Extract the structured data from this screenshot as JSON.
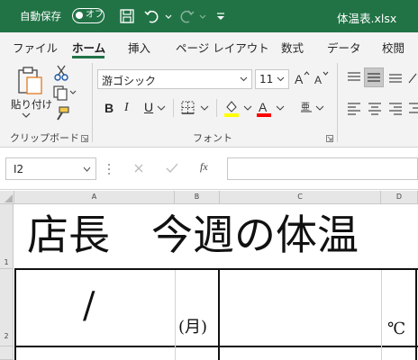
{
  "titlebar": {
    "autosave_label": "自動保存",
    "autosave_state": "オフ",
    "filename": "体温表.xlsx",
    "accent_color": "#217346"
  },
  "tabs": [
    {
      "label": "ファイル",
      "active": false
    },
    {
      "label": "ホーム",
      "active": true
    },
    {
      "label": "挿入",
      "active": false
    },
    {
      "label": "ページ レイアウト",
      "active": false
    },
    {
      "label": "数式",
      "active": false
    },
    {
      "label": "データ",
      "active": false
    },
    {
      "label": "校閲",
      "active": false
    }
  ],
  "ribbon": {
    "clipboard": {
      "paste_label": "貼り付け",
      "group_label": "クリップボード"
    },
    "font": {
      "font_name": "游ゴシック",
      "font_size": "11",
      "group_label": "フォント",
      "bold_label": "B",
      "italic_label": "I",
      "underline_label": "U",
      "highlight_color": "#ffff00",
      "font_color": "#ff0000",
      "phonetic_glyph": "亜"
    }
  },
  "formula_bar": {
    "name_box": "I2",
    "fx_label": "fx",
    "formula": ""
  },
  "grid": {
    "columns": [
      "A",
      "B",
      "C",
      "D"
    ],
    "rows": [
      "1",
      "2"
    ],
    "cells": {
      "row1_title": "店長　今週の体温",
      "a2": "/",
      "b2": "(月)",
      "d2": "℃"
    }
  }
}
